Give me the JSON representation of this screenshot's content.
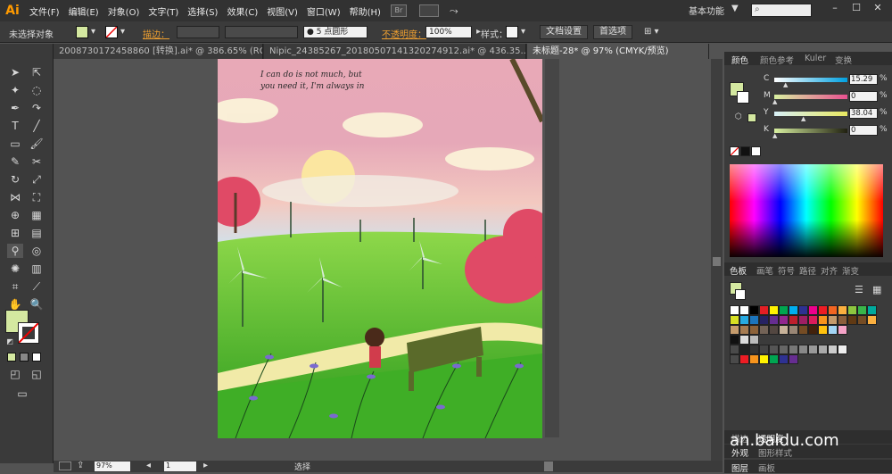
{
  "app": {
    "logo": "Ai"
  },
  "menu": [
    "文件(F)",
    "编辑(E)",
    "对象(O)",
    "文字(T)",
    "选择(S)",
    "效果(C)",
    "视图(V)",
    "窗口(W)",
    "帮助(H)"
  ],
  "menubar": {
    "br_label": "Br",
    "workspace": "基本功能",
    "workspace_arrow": "▼",
    "search_placeholder": ""
  },
  "control": {
    "selection": "未选择对象",
    "stroke_label": "描边：",
    "brush_label": "5 点圆形",
    "opacity_label": "不透明度：",
    "opacity_value": "100%",
    "style_label": "样式：",
    "doc_setup": "文档设置",
    "prefs": "首选项"
  },
  "tabs": [
    {
      "label": "20087301724588​60 [转换].ai* @ 386.65% (RGB/预...",
      "active": false
    },
    {
      "label": "Nipic_24385267_20180507141320274912.ai* @ 436.35...",
      "active": false
    },
    {
      "label": "未标题-28* @ 97% (CMYK/预览)",
      "active": true
    }
  ],
  "artwork": {
    "quote_line1": "I can do is not much, but",
    "quote_line2": "you need it, I'm always in"
  },
  "color_panel": {
    "tabs": [
      "颜色",
      "颜色参考",
      "Kuler",
      "变换"
    ],
    "active_tab": "颜色",
    "c_label": "C",
    "m_label": "M",
    "y_label": "Y",
    "k_label": "K",
    "c": "15.29",
    "m": "0",
    "y": "38.04",
    "k": "0",
    "pct": "%",
    "fill_color": "#d4e8a0"
  },
  "swatch_panel": {
    "tabs": [
      "色板",
      "画笔",
      "符号",
      "路径",
      "对齐",
      "渐变"
    ],
    "active_tab": "色板"
  },
  "bottom_panels": {
    "row1": [
      "描边",
      "透明度"
    ],
    "row2": [
      "外观",
      "图形样式"
    ],
    "row3": [
      "图层",
      "画板"
    ]
  },
  "status": {
    "zoom": "97%",
    "page": "1",
    "mode": "选择"
  },
  "watermark": "an.baidu.com"
}
